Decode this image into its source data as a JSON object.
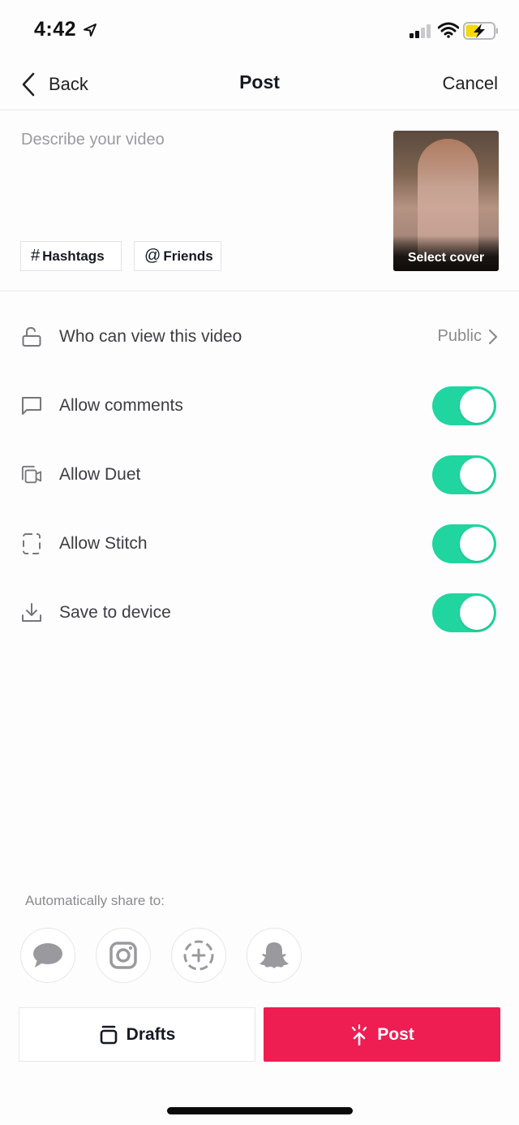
{
  "status_bar": {
    "time": "4:42",
    "location_icon": "location-arrow-icon",
    "signal_icon": "cellular-signal-icon",
    "signal_bars_active": 2,
    "signal_bars_total": 4,
    "wifi_icon": "wifi-icon",
    "battery_icon": "battery-charging-icon",
    "battery_color": "#f5d90a"
  },
  "nav": {
    "back_label": "Back",
    "title": "Post",
    "cancel_label": "Cancel"
  },
  "description": {
    "value": "",
    "placeholder": "Describe your video",
    "chips": [
      {
        "symbol": "#",
        "label": "Hashtags"
      },
      {
        "symbol": "@",
        "label": "Friends"
      }
    ],
    "cover_label": "Select cover"
  },
  "settings": {
    "privacy": {
      "icon": "unlock-icon",
      "label": "Who can view this video",
      "value": "Public"
    },
    "toggles": [
      {
        "icon": "comment-icon",
        "label": "Allow comments",
        "on": true
      },
      {
        "icon": "duet-icon",
        "label": "Allow Duet",
        "on": true
      },
      {
        "icon": "stitch-icon",
        "label": "Allow Stitch",
        "on": true
      },
      {
        "icon": "download-icon",
        "label": "Save to device",
        "on": true
      }
    ],
    "toggle_on_color": "#20d5a0"
  },
  "share": {
    "label": "Automatically share to:",
    "targets": [
      {
        "name": "Messages",
        "icon": "message-bubble-icon"
      },
      {
        "name": "Instagram",
        "icon": "instagram-icon"
      },
      {
        "name": "Story",
        "icon": "add-story-icon"
      },
      {
        "name": "Snapchat",
        "icon": "snapchat-ghost-icon"
      }
    ]
  },
  "actions": {
    "drafts_label": "Drafts",
    "post_label": "Post",
    "post_color": "#ee1d52"
  }
}
